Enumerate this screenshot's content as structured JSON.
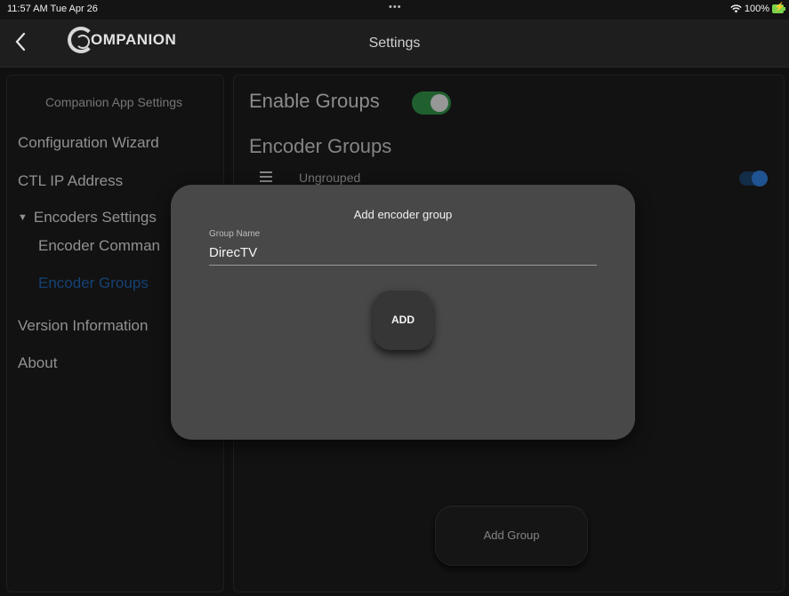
{
  "status_bar": {
    "time": "11:57 AM  Tue Apr 26",
    "dots": "•••",
    "wifi_icon": "wifi-icon",
    "battery_text": "100%"
  },
  "header": {
    "back_icon": "chevron-left-icon",
    "logo_text": "OMPANION",
    "title": "Settings"
  },
  "sidebar": {
    "heading": "Companion App Settings",
    "items": {
      "config_wizard": "Configuration Wizard",
      "ctl_ip": "CTL IP Address",
      "encoders_settings": "Encoders Settings",
      "encoder_commands": "Encoder Comman",
      "encoder_groups": "Encoder Groups",
      "version_info": "Version Information",
      "about": "About"
    },
    "active_color": "#1f5ea8"
  },
  "main": {
    "enable_groups_label": "Enable Groups",
    "enable_groups_on": true,
    "encoder_groups_heading": "Encoder Groups",
    "groups": [
      {
        "name": "Ungrouped",
        "enabled": true
      }
    ],
    "add_group_label": "Add Group"
  },
  "dialog": {
    "title": "Add encoder group",
    "field_label": "Group Name",
    "field_value": "DirecTV",
    "add_label": "ADD"
  },
  "colors": {
    "toggle_green": "#2e8a43",
    "toggle_blue": "#2f78d0",
    "battery": "#7ad34b"
  }
}
